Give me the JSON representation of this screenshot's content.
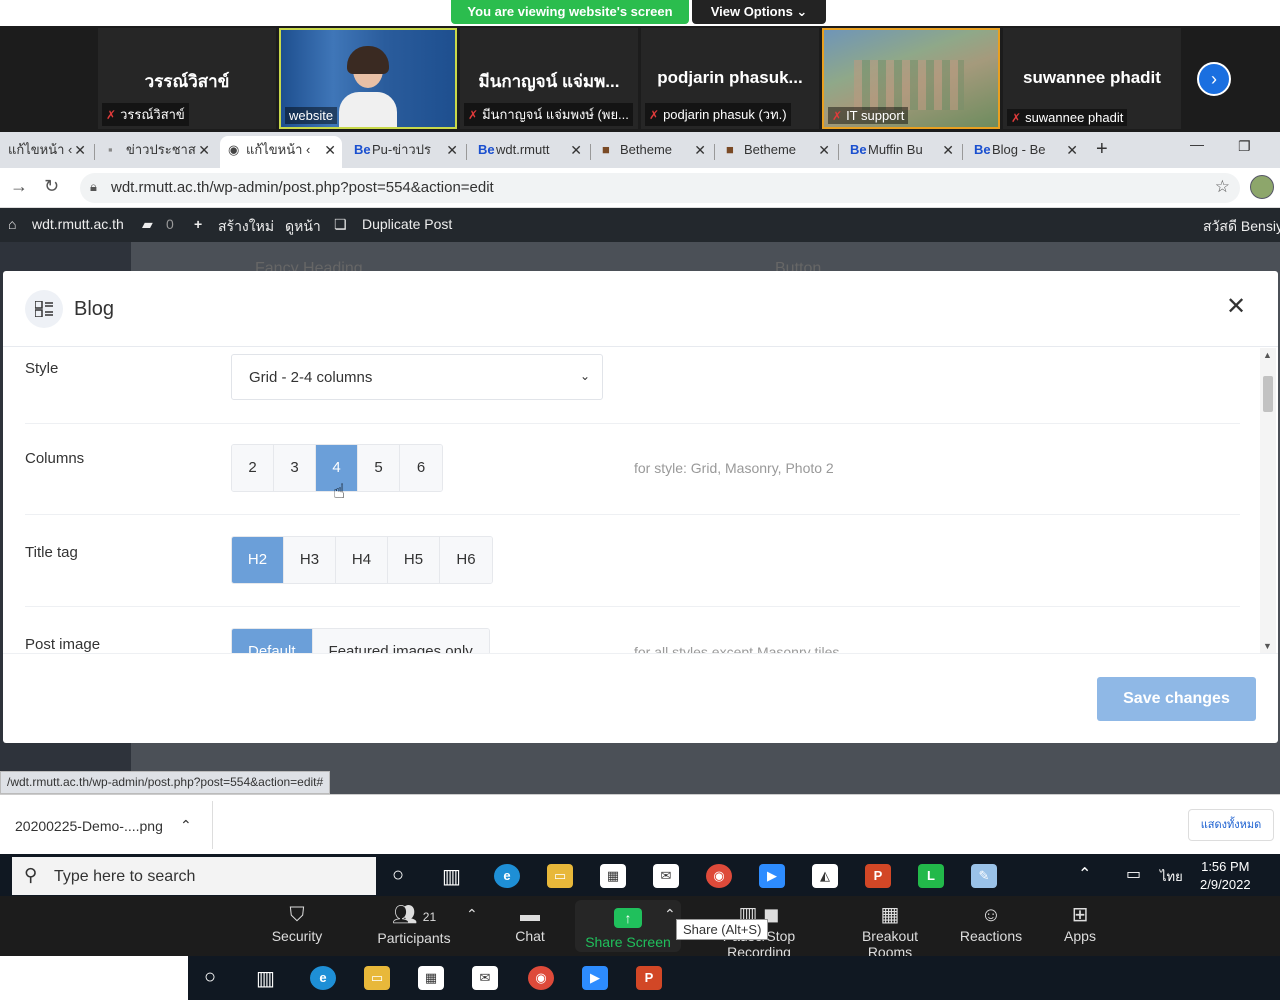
{
  "zoom": {
    "banner": "You are viewing website's screen",
    "view_options": "View Options ⌄",
    "participants": [
      {
        "display": "วรรณ์วิสาข์",
        "label": "วรรณ์วิสาข์"
      },
      {
        "display": "",
        "label": "website"
      },
      {
        "display": "มีนกาญจน์ แจ่มพ...",
        "label": "มีนกาญจน์ แจ่มพงษ์ (พย..."
      },
      {
        "display": "podjarin  phasuk...",
        "label": "podjarin phasuk (วท.)"
      },
      {
        "display": "",
        "label": "IT support"
      },
      {
        "display": "suwannee phadit",
        "label": "suwannee phadit"
      }
    ],
    "toolbar": {
      "security": "Security",
      "participants": "Participants",
      "participants_count": "21",
      "chat": "Chat",
      "share_screen": "Share Screen",
      "share_tip": "Share (Alt+S)",
      "recording": "Pause/Stop Recording",
      "breakout": "Breakout Rooms",
      "reactions": "Reactions",
      "apps": "Apps"
    }
  },
  "browser": {
    "tabs": [
      {
        "label": "แก้ไขหน้า ‹"
      },
      {
        "label": "ข่าวประชาส"
      },
      {
        "label": "แก้ไขหน้า ‹"
      },
      {
        "label": "Pu-ข่าวปร"
      },
      {
        "label": "wdt.rmutt"
      },
      {
        "label": "Betheme"
      },
      {
        "label": "Betheme"
      },
      {
        "label": "Muffin Bu"
      },
      {
        "label": "Blog - Be"
      }
    ],
    "url": "wdt.rmutt.ac.th/wp-admin/post.php?post=554&action=edit",
    "status_url": "/wdt.rmutt.ac.th/wp-admin/post.php?post=554&action=edit#"
  },
  "wpbar": {
    "site": "wdt.rmutt.ac.th",
    "comments": "0",
    "new": "สร้างใหม่",
    "view": "ดูหน้า",
    "duplicate": "Duplicate Post",
    "greeting": "สวัสดี Bensiya"
  },
  "backdrop": {
    "item1": "Fancy Heading",
    "item2": "Button"
  },
  "modal": {
    "title": "Blog",
    "style_label": "Style",
    "style_value": "Grid - 2-4 columns",
    "columns_label": "Columns",
    "columns_options": [
      "2",
      "3",
      "4",
      "5",
      "6"
    ],
    "columns_selected": "4",
    "columns_hint": "for style: Grid, Masonry, Photo 2",
    "title_tag_label": "Title tag",
    "title_tag_options": [
      "H2",
      "H3",
      "H4",
      "H5",
      "H6"
    ],
    "title_tag_selected": "H2",
    "post_image_label": "Post image",
    "post_image_options": [
      "Default",
      "Featured images only"
    ],
    "post_image_selected": "Default",
    "post_image_hint": "for all styles except Masonry tiles",
    "save": "Save changes"
  },
  "downloads": {
    "file": "20200225-Demo-....png",
    "show_all": "แสดงทั้งหมด"
  },
  "taskbar": {
    "search_placeholder": "Type here to search",
    "lang": "ไทย",
    "time": "1:56 PM",
    "date": "2/9/2022"
  }
}
